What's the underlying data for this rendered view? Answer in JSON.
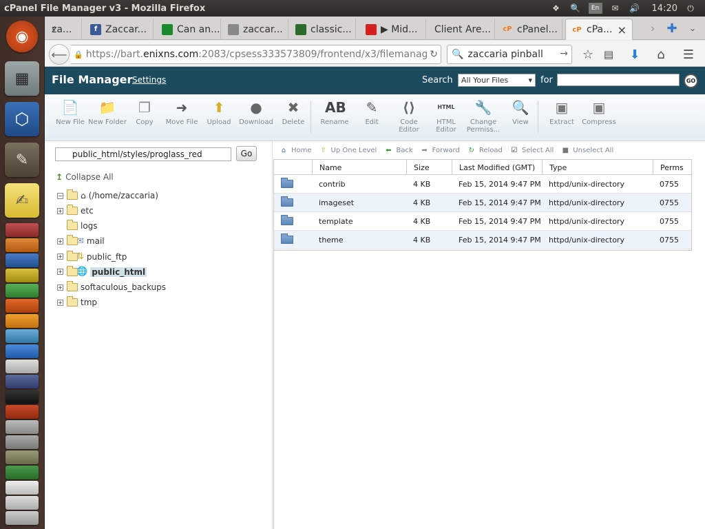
{
  "window": {
    "title": "cPanel File Manager v3 - Mozilla Firefox",
    "clock": "14:20",
    "keyboard": "En"
  },
  "tabs": [
    {
      "label": "za...",
      "icon": "generic"
    },
    {
      "label": "Zaccar...",
      "icon": "facebook-icon"
    },
    {
      "label": "Can an...",
      "icon": "game-icon"
    },
    {
      "label": "zaccar...",
      "icon": "generic"
    },
    {
      "label": "classic...",
      "icon": "globe-icon"
    },
    {
      "label": "▶ Mid...",
      "icon": "youtube-icon"
    },
    {
      "label": "Client Are...",
      "icon": "generic"
    },
    {
      "label": "cPanel...",
      "icon": "cpanel-icon"
    },
    {
      "label": "cPa...",
      "icon": "cpanel-icon",
      "active": true
    }
  ],
  "nav": {
    "url_prefix": "https://bart.",
    "url_host": "enixns.com",
    "url_rest": ":2083/cpsess333573809/frontend/x3/filemanag",
    "search": "zaccaria pinball"
  },
  "cpanel": {
    "title": "File Manager",
    "settings": "Settings",
    "search_label": "Search",
    "search_scope": "All Your Files",
    "for_label": "for",
    "go": "GO"
  },
  "toolbar": [
    {
      "label": "New File",
      "icon": "new-file-icon"
    },
    {
      "label": "New Folder",
      "icon": "new-folder-icon"
    },
    {
      "label": "Copy",
      "icon": "copy-icon"
    },
    {
      "label": "Move File",
      "icon": "move-file-icon"
    },
    {
      "label": "Upload",
      "icon": "upload-icon"
    },
    {
      "label": "Download",
      "icon": "download-icon"
    },
    {
      "label": "Delete",
      "icon": "delete-icon"
    },
    {
      "label": "Rename",
      "icon": "rename-icon"
    },
    {
      "label": "Edit",
      "icon": "edit-icon"
    },
    {
      "label": "Code Editor",
      "icon": "code-editor-icon"
    },
    {
      "label": "HTML Editor",
      "icon": "html-editor-icon"
    },
    {
      "label": "Change Permiss...",
      "icon": "permissions-icon"
    },
    {
      "label": "View",
      "icon": "view-icon"
    },
    {
      "label": "Extract",
      "icon": "extract-icon"
    },
    {
      "label": "Compress",
      "icon": "compress-icon"
    }
  ],
  "left": {
    "path": "public_html/styles/proglass_red",
    "go": "Go",
    "collapse": "Collapse All",
    "root": "(/home/zaccaria)",
    "tree": [
      {
        "label": "etc",
        "toggle": "+"
      },
      {
        "label": "logs",
        "toggle": ""
      },
      {
        "label": "mail",
        "toggle": "+"
      },
      {
        "label": "public_ftp",
        "toggle": "+"
      },
      {
        "label": "public_html",
        "toggle": "+",
        "selected": true
      },
      {
        "label": "softaculous_backups",
        "toggle": "+"
      },
      {
        "label": "tmp",
        "toggle": "+"
      }
    ]
  },
  "listnav": [
    "Home",
    "Up One Level",
    "Back",
    "Forward",
    "Reload",
    "Select All",
    "Unselect All"
  ],
  "table": {
    "headers": [
      "Name",
      "Size",
      "Last Modified (GMT)",
      "Type",
      "Perms"
    ],
    "rows": [
      [
        "contrib",
        "4 KB",
        "Feb 15, 2014 9:47 PM",
        "httpd/unix-directory",
        "0755"
      ],
      [
        "imageset",
        "4 KB",
        "Feb 15, 2014 9:47 PM",
        "httpd/unix-directory",
        "0755"
      ],
      [
        "template",
        "4 KB",
        "Feb 15, 2014 9:47 PM",
        "httpd/unix-directory",
        "0755"
      ],
      [
        "theme",
        "4 KB",
        "Feb 15, 2014 9:47 PM",
        "httpd/unix-directory",
        "0755"
      ]
    ]
  },
  "colors": {
    "header": "#1c4a5e",
    "accent": "#1f6f95",
    "row_alt": "#edf3fa"
  }
}
